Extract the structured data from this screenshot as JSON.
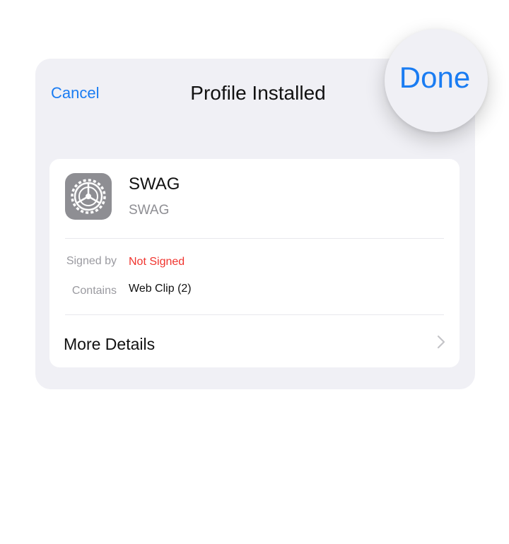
{
  "nav": {
    "cancel_label": "Cancel",
    "title": "Profile Installed",
    "done_label": "Done"
  },
  "profile": {
    "icon": "settings-gear-icon",
    "name": "SWAG",
    "subtitle": "SWAG"
  },
  "details": {
    "signed_by_label": "Signed by",
    "signed_by_value": "Not Signed",
    "contains_label": "Contains",
    "contains_value": "Web Clip (2)"
  },
  "more_details_label": "More Details",
  "colors": {
    "accent": "#1a7cf2",
    "warning": "#f0342e",
    "sheet_bg": "#f0f0f5"
  }
}
